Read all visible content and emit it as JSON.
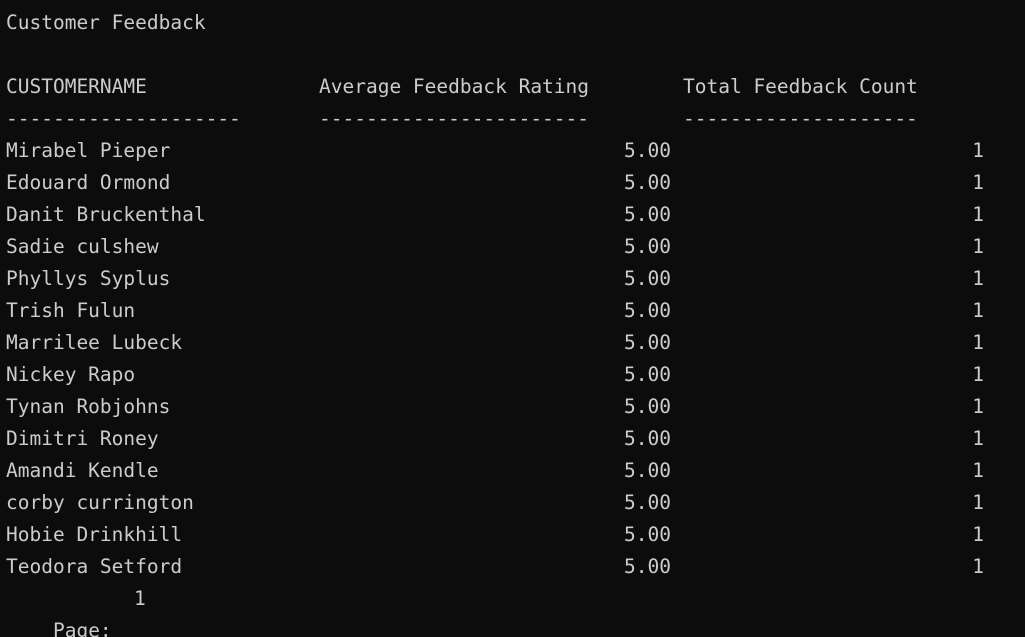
{
  "title": "Customer Feedback",
  "columns": {
    "name": "CUSTOMERNAME",
    "avg": "Average Feedback Rating",
    "count": "Total Feedback Count"
  },
  "separators": {
    "name": "--------------------",
    "avg": "-----------------------",
    "count": "--------------------"
  },
  "rows": [
    {
      "name": "Mirabel Pieper",
      "avg": "5.00",
      "count": "1"
    },
    {
      "name": "Edouard Ormond",
      "avg": "5.00",
      "count": "1"
    },
    {
      "name": "Danit Bruckenthal",
      "avg": "5.00",
      "count": "1"
    },
    {
      "name": "Sadie culshew",
      "avg": "5.00",
      "count": "1"
    },
    {
      "name": "Phyllys Syplus",
      "avg": "5.00",
      "count": "1"
    },
    {
      "name": "Trish Fulun",
      "avg": "5.00",
      "count": "1"
    },
    {
      "name": "Marrilee Lubeck",
      "avg": "5.00",
      "count": "1"
    },
    {
      "name": "Nickey Rapo",
      "avg": "5.00",
      "count": "1"
    },
    {
      "name": "Tynan Robjohns",
      "avg": "5.00",
      "count": "1"
    },
    {
      "name": "Dimitri Roney",
      "avg": "5.00",
      "count": "1"
    },
    {
      "name": "Amandi Kendle",
      "avg": "5.00",
      "count": "1"
    },
    {
      "name": "corby currington",
      "avg": "5.00",
      "count": "1"
    },
    {
      "name": "Hobie Drinkhill",
      "avg": "5.00",
      "count": "1"
    },
    {
      "name": "Teodora Setford",
      "avg": "5.00",
      "count": "1"
    }
  ],
  "page": {
    "label": "Page:",
    "number": "1"
  },
  "colors": {
    "background": "#0c0c0c",
    "text": "#cccccc"
  }
}
